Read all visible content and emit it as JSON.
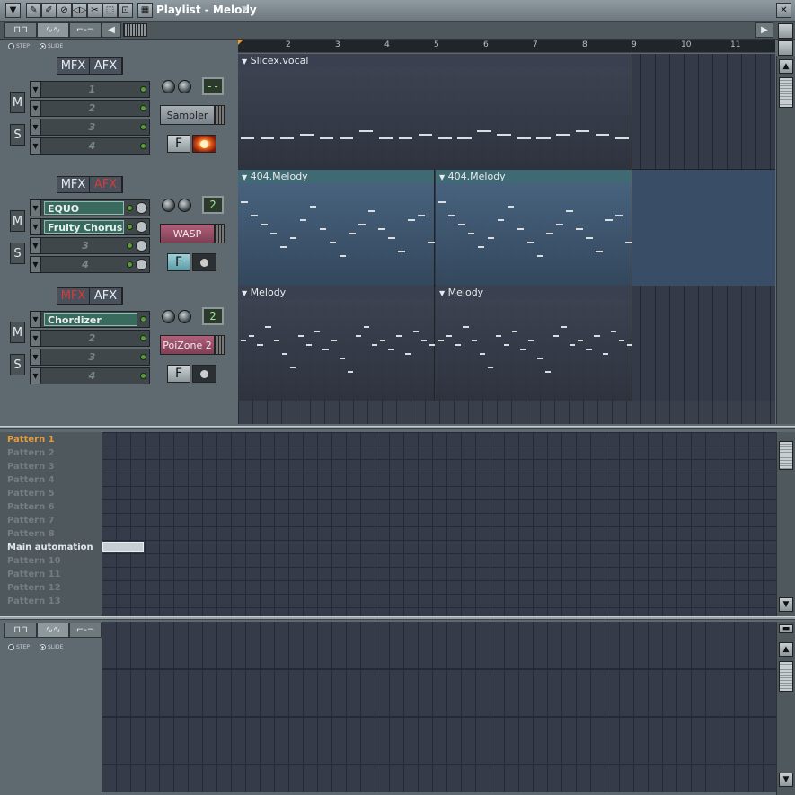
{
  "window": {
    "title": "Playlist - Melody"
  },
  "left_tabs": {
    "step": "STEP",
    "slide": "SLIDE"
  },
  "channels": [
    {
      "mfx": "MFX",
      "afx": "AFX",
      "m": "M",
      "s": "S",
      "slots": [
        {
          "name": "1",
          "filled": false
        },
        {
          "name": "2",
          "filled": false
        },
        {
          "name": "3",
          "filled": false
        },
        {
          "name": "4",
          "filled": false
        }
      ],
      "lcd": "--",
      "generator": "Sampler",
      "f": "F"
    },
    {
      "mfx": "MFX",
      "afx": "AFX",
      "m": "M",
      "s": "S",
      "slots": [
        {
          "name": "EQUO",
          "filled": true
        },
        {
          "name": "Fruity Chorus",
          "filled": true
        },
        {
          "name": "3",
          "filled": false
        },
        {
          "name": "4",
          "filled": false
        }
      ],
      "lcd": "2",
      "generator": "WASP",
      "f": "F"
    },
    {
      "mfx": "MFX",
      "afx": "AFX",
      "m": "M",
      "s": "S",
      "slots": [
        {
          "name": "Chordizer",
          "filled": true
        },
        {
          "name": "2",
          "filled": false
        },
        {
          "name": "3",
          "filled": false
        },
        {
          "name": "4",
          "filled": false
        }
      ],
      "lcd": "2",
      "generator": "PoiZone 2",
      "f": "F"
    }
  ],
  "ruler": [
    "2",
    "3",
    "4",
    "5",
    "6",
    "7",
    "8",
    "9",
    "10",
    "11"
  ],
  "tracks": [
    {
      "clips": [
        {
          "name": "Slicex.vocal"
        }
      ]
    },
    {
      "clips": [
        {
          "name": "404.Melody"
        },
        {
          "name": "404.Melody"
        }
      ]
    },
    {
      "clips": [
        {
          "name": "Melody"
        },
        {
          "name": "Melody"
        }
      ]
    }
  ],
  "patterns": [
    "Pattern 1",
    "Pattern 2",
    "Pattern 3",
    "Pattern 4",
    "Pattern 5",
    "Pattern 6",
    "Pattern 7",
    "Pattern 8",
    "Main automation",
    "Pattern 10",
    "Pattern 11",
    "Pattern 12",
    "Pattern 13"
  ],
  "colors": {
    "accent_orange": "#e69a3a",
    "afx_red": "#d83a3a",
    "clip_teal": "#3f6a73"
  }
}
